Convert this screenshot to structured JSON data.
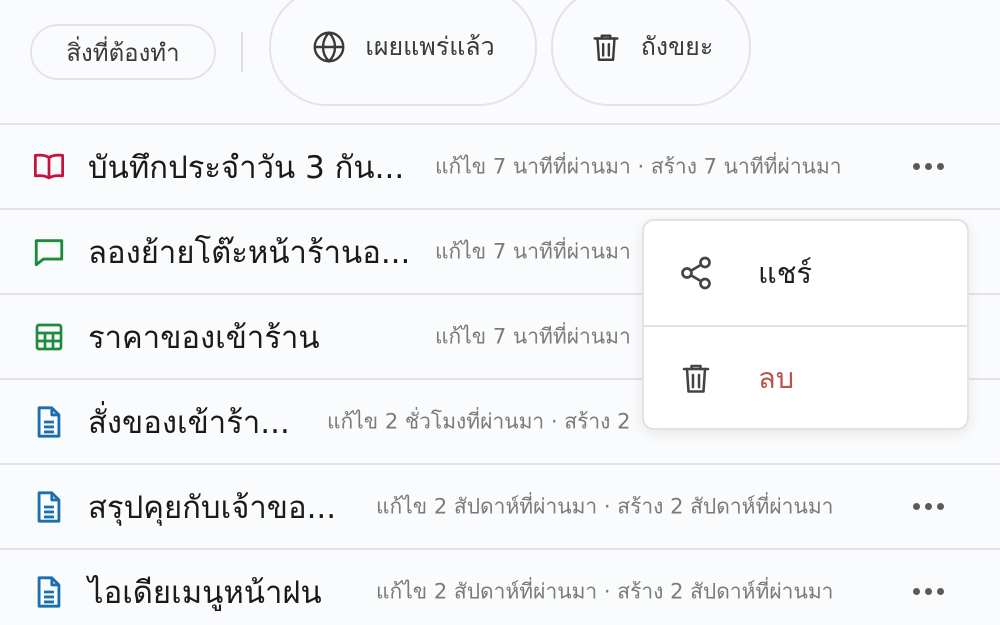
{
  "filters": {
    "todo_label": "สิ่งที่ต้องทำ",
    "published_label": "เผยแพร่แล้ว",
    "trash_label": "ถังขยะ",
    "published_icon": "globe-icon",
    "trash_icon": "trash-icon"
  },
  "rows": [
    {
      "icon": "journal-book-icon",
      "icon_color": "#c8103c",
      "title": "บันทึกประจำวัน 3 กัน...",
      "meta": "แก้ไข 7 นาทีที่ผ่านมา · สร้าง 7 นาทีที่ผ่านมา"
    },
    {
      "icon": "chat-bubble-icon",
      "icon_color": "#1e8a3c",
      "title": "ลองย้ายโต๊ะหน้าร้านอ...",
      "meta": "แก้ไข 7 นาทีที่ผ่านมา"
    },
    {
      "icon": "spreadsheet-icon",
      "icon_color": "#1e8a3c",
      "title": "ราคาของเข้าร้าน",
      "meta": "แก้ไข 7 นาทีที่ผ่านมา"
    },
    {
      "icon": "document-icon",
      "icon_color": "#1a6fb0",
      "title": "สั่งของเข้าร้า...",
      "meta": "แก้ไข 2 ชั่วโมงที่ผ่านมา · สร้าง 2"
    },
    {
      "icon": "document-icon",
      "icon_color": "#1a6fb0",
      "title": "สรุปคุยกับเจ้าขอ...",
      "meta": "แก้ไข 2 สัปดาห์ที่ผ่านมา · สร้าง 2 สัปดาห์ที่ผ่านมา"
    },
    {
      "icon": "document-icon",
      "icon_color": "#1a6fb0",
      "title": "ไอเดียเมนูหน้าฝน",
      "meta": "แก้ไข 2 สัปดาห์ที่ผ่านมา · สร้าง 2 สัปดาห์ที่ผ่านมา"
    }
  ],
  "menu": {
    "share_label": "แชร์",
    "delete_label": "ลบ",
    "share_icon": "share-icon",
    "delete_icon": "trash-icon",
    "delete_color": "#b5574b"
  }
}
